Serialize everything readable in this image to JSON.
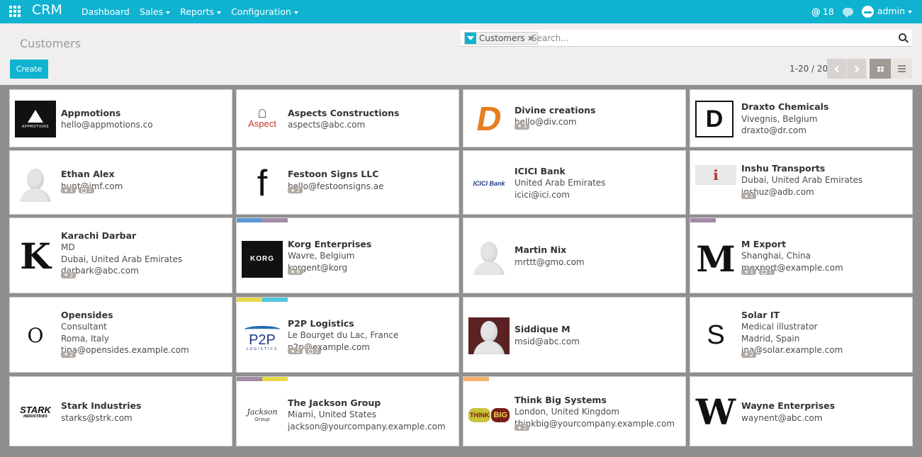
{
  "app": {
    "brand": "CRM",
    "nav": [
      "Dashboard",
      "Sales",
      "Reports",
      "Configuration"
    ],
    "nav_dropdown": [
      false,
      true,
      true,
      true
    ]
  },
  "topright": {
    "mentions": "18",
    "user": "admin"
  },
  "control": {
    "breadcrumb": "Customers",
    "facet": "Customers",
    "search_placeholder": "Search...",
    "create_label": "Create",
    "pager": "1-20 / 20"
  },
  "colors": {
    "accent": "#0fb3d0",
    "board_bg": "#8f8f8f"
  },
  "cards": [
    {
      "name": "Appmotions",
      "lines": [
        "hello@appmotions.co"
      ],
      "logo": "appmotions-logo",
      "logo_text": "APPMOTIONS",
      "badges": []
    },
    {
      "name": "Aspects Constructions",
      "lines": [
        "aspects@abc.com"
      ],
      "logo": "aspect-logo",
      "logo_text": "Aspect",
      "badges": []
    },
    {
      "name": "Divine creations",
      "lines": [
        "hello@div.com"
      ],
      "logo": "divine-logo",
      "logo_text": "D",
      "badges": [
        {
          "icon": "star",
          "count": "3"
        }
      ]
    },
    {
      "name": "Draxto Chemicals",
      "lines": [
        "Vivegnis, Belgium",
        "draxto@dr.com"
      ],
      "logo": "draxto-logo",
      "logo_text": "D",
      "badges": []
    },
    {
      "name": "Ethan Alex",
      "lines": [
        "hunt@imf.com"
      ],
      "logo": "person-placeholder",
      "badges": [
        {
          "icon": "star",
          "count": "1"
        },
        {
          "icon": "calendar",
          "count": "1"
        }
      ]
    },
    {
      "name": "Festoon Signs LLC",
      "lines": [
        "hello@festoonsigns.ae"
      ],
      "logo": "festoon-logo",
      "logo_text": "f",
      "badges": [
        {
          "icon": "star",
          "count": "2"
        }
      ]
    },
    {
      "name": "ICICI Bank",
      "lines": [
        "United Arab Emirates",
        "icici@ici.com"
      ],
      "logo": "icici-logo",
      "logo_text": "ICICI Bank",
      "badges": []
    },
    {
      "name": "Inshu Transports",
      "lines": [
        "Dubai, United Arab Emirates",
        "inshuz@adb.com"
      ],
      "logo": "inshu-logo",
      "logo_text": "i",
      "badges": [
        {
          "icon": "star",
          "count": "1"
        }
      ]
    },
    {
      "name": "Karachi Darbar",
      "lines": [
        "MD",
        "Dubai, United Arab Emirates",
        "darbark@abc.com"
      ],
      "logo": "karachi-logo",
      "logo_text": "K",
      "badges": [
        {
          "icon": "star",
          "count": "2"
        }
      ]
    },
    {
      "name": "Korg Enterprises",
      "lines": [
        "Wavre, Belgium",
        "korgent@korg"
      ],
      "logo": "korg-logo",
      "logo_text": "KORG",
      "tags": [
        "#5a9bd5",
        "#a48aa8"
      ],
      "badges": [
        {
          "icon": "star",
          "count": "6"
        }
      ]
    },
    {
      "name": "Martin Nix",
      "lines": [
        "mrttt@gmo.com"
      ],
      "logo": "person-placeholder",
      "badges": []
    },
    {
      "name": "M Export",
      "lines": [
        "Shanghai, China",
        "mexport@example.com"
      ],
      "logo": "mexport-logo",
      "logo_text": "M",
      "tags": [
        "#a48aa8"
      ],
      "badges": [
        {
          "icon": "star",
          "count": "1"
        },
        {
          "icon": "calendar",
          "count": "1"
        }
      ]
    },
    {
      "name": "Opensides",
      "lines": [
        "Consultant",
        "Roma, Italy",
        "tipa@opensides.example.com"
      ],
      "logo": "opensides-logo",
      "logo_text": "O",
      "badges": [
        {
          "icon": "star",
          "count": "2"
        }
      ]
    },
    {
      "name": "P2P Logistics",
      "lines": [
        "Le Bourget du Lac, France",
        "p2p@example.com"
      ],
      "logo": "p2p-logo",
      "logo_text": "P2P",
      "logo_sub": "LOGISTICS",
      "tags": [
        "#e8d84a",
        "#4fc7e3"
      ],
      "badges": [
        {
          "icon": "star",
          "count": "2"
        },
        {
          "icon": "calendar",
          "count": "2"
        }
      ]
    },
    {
      "name": "Siddique M",
      "lines": [
        "msid@abc.com"
      ],
      "logo": "person-dark",
      "badges": []
    },
    {
      "name": "Solar IT",
      "lines": [
        "Medical illustrator",
        "Madrid, Spain",
        "ina@solar.example.com"
      ],
      "logo": "solar-logo",
      "logo_text": "S",
      "badges": [
        {
          "icon": "star",
          "count": "2"
        }
      ]
    },
    {
      "name": "Stark Industries",
      "lines": [
        "starks@strk.com"
      ],
      "logo": "stark-logo",
      "logo_text": "STARK",
      "logo_sub": "INDUSTRIES",
      "badges": []
    },
    {
      "name": "The Jackson Group",
      "lines": [
        "Miami, United States",
        "jackson@yourcompany.example.com"
      ],
      "logo": "jackson-logo",
      "logo_text": "Jackson",
      "logo_sub": "Group",
      "tags": [
        "#a48aa8",
        "#e8d84a"
      ],
      "badges": []
    },
    {
      "name": "Think Big Systems",
      "lines": [
        "London, United Kingdom",
        "thinkbig@yourcompany.example.com"
      ],
      "logo": "thinkbig-logo",
      "logo_text": "THINK",
      "logo_sub": "BIG",
      "tags": [
        "#f6b26b"
      ],
      "badges": [
        {
          "icon": "star",
          "count": "1"
        }
      ]
    },
    {
      "name": "Wayne Enterprises",
      "lines": [
        "waynent@abc.com"
      ],
      "logo": "wayne-logo",
      "logo_text": "W",
      "badges": []
    }
  ]
}
